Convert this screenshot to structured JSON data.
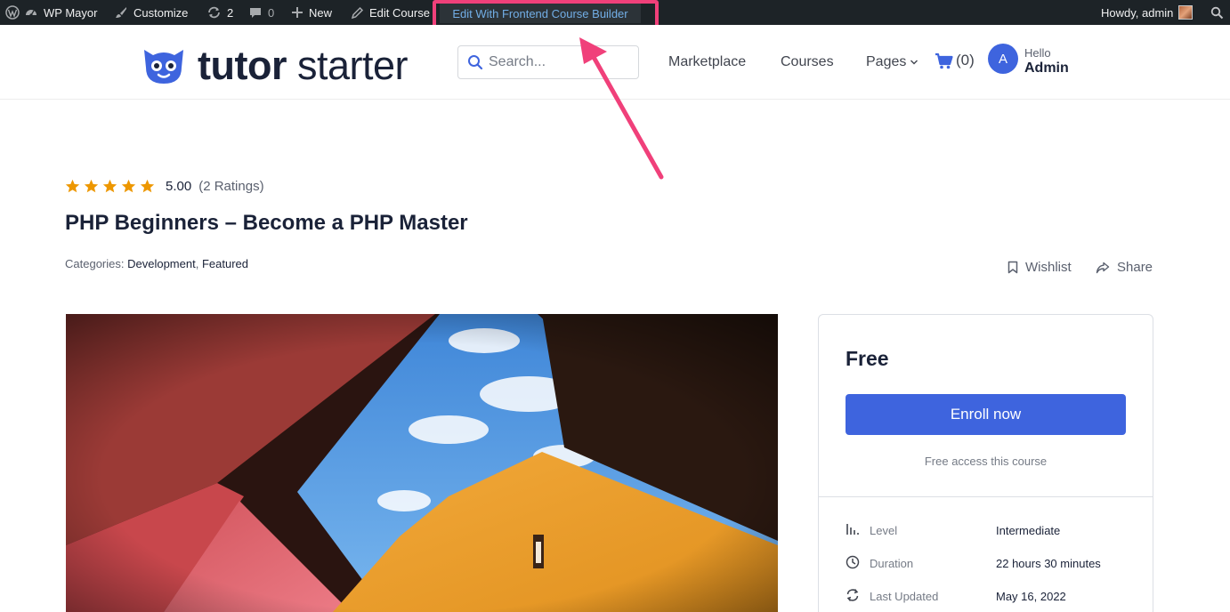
{
  "admin_bar": {
    "site_name": "WP Mayor",
    "customize": "Customize",
    "updates_count": "2",
    "comments_count": "0",
    "new": "New",
    "edit_course": "Edit Course",
    "frontend_builder": "Edit With Frontend Course Builder",
    "howdy": "Howdy, admin"
  },
  "header": {
    "logo_bold": "tutor",
    "logo_regular": "starter",
    "search_placeholder": "Search...",
    "nav": {
      "marketplace": "Marketplace",
      "courses": "Courses",
      "pages": "Pages"
    },
    "cart_count": "(0)",
    "user_initial": "A",
    "hello": "Hello",
    "user_name": "Admin"
  },
  "course": {
    "stars": 5,
    "rating_value": "5.00",
    "rating_count": "(2 Ratings)",
    "title": "PHP Beginners – Become a PHP Master",
    "categories_label": "Categories:",
    "categories": [
      "Development",
      "Featured"
    ],
    "wishlist": "Wishlist",
    "share": "Share"
  },
  "enrollment": {
    "price": "Free",
    "enroll_button": "Enroll now",
    "note": "Free access this course",
    "meta": [
      {
        "label": "Level",
        "value": "Intermediate"
      },
      {
        "label": "Duration",
        "value": "22 hours  30 minutes"
      },
      {
        "label": "Last Updated",
        "value": "May 16, 2022"
      }
    ]
  },
  "colors": {
    "admin_bar": "#1d2327",
    "brand_blue": "#3e64de",
    "star": "#ed9700",
    "annotation": "#f0407a"
  }
}
